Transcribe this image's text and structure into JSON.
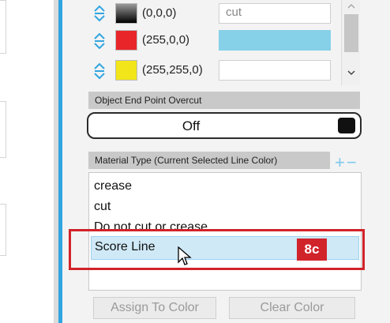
{
  "colors": {
    "accent_blue": "#31a5e0",
    "callout_red": "#d1232a",
    "selection_bg": "#cfe9f7"
  },
  "color_rows": [
    {
      "rgb": "(0,0,0)",
      "value": "cut",
      "swatch": "gradient-black",
      "value_fill": "#ffffff"
    },
    {
      "rgb": "(255,0,0)",
      "value": "",
      "swatch": "#e8262a",
      "value_fill": "#86d0e8"
    },
    {
      "rgb": "(255,255,0)",
      "value": "",
      "swatch": "#f2e51a",
      "value_fill": "#ffffff"
    }
  ],
  "overcut": {
    "header": "Object End Point Overcut",
    "toggle_label": "Off"
  },
  "material": {
    "header": "Material Type (Current Selected Line Color)",
    "add_remove": "+−",
    "items": [
      "crease",
      "cut",
      "Do not cut or crease"
    ],
    "selected": "Score Line"
  },
  "callout": {
    "tag": "8c"
  },
  "buttons": {
    "assign": "Assign To Color",
    "clear": "Clear Color"
  }
}
